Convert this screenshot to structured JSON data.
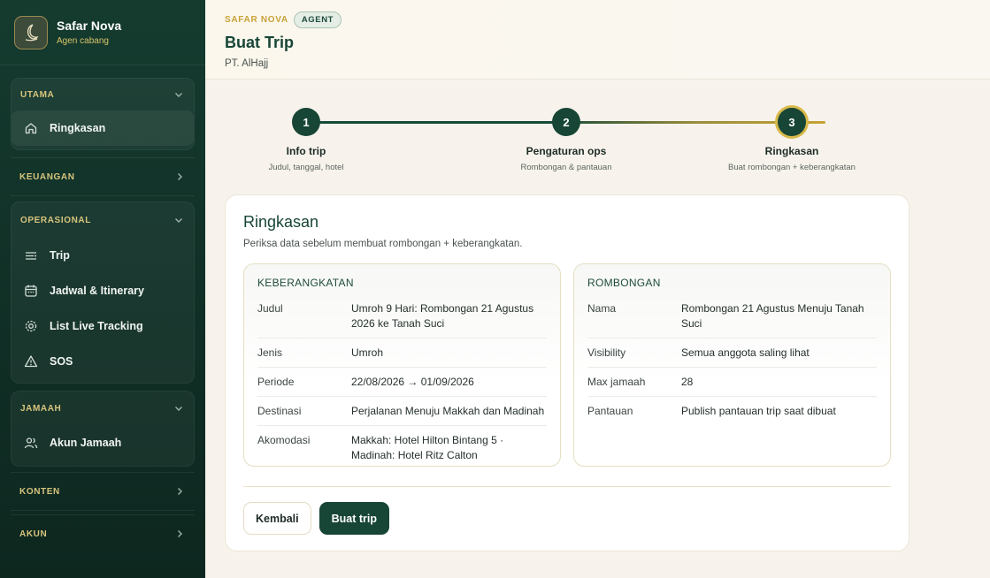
{
  "brand": {
    "name": "Safar Nova",
    "subtitle": "Agen cabang"
  },
  "sidebar": {
    "groups": [
      {
        "label": "UTAMA",
        "expanded": true,
        "items": [
          {
            "label": "Ringkasan",
            "icon": "home-icon"
          }
        ]
      },
      {
        "label": "KEUANGAN",
        "expanded": false,
        "items": []
      },
      {
        "label": "OPERASIONAL",
        "expanded": true,
        "items": [
          {
            "label": "Trip",
            "icon": "list-icon"
          },
          {
            "label": "Jadwal & Itinerary",
            "icon": "calendar-icon"
          },
          {
            "label": "List Live Tracking",
            "icon": "gear-icon"
          },
          {
            "label": "SOS",
            "icon": "warning-icon"
          }
        ]
      },
      {
        "label": "JAMAAH",
        "expanded": true,
        "items": [
          {
            "label": "Akun Jamaah",
            "icon": "users-icon"
          }
        ]
      },
      {
        "label": "KONTEN",
        "expanded": false,
        "items": []
      },
      {
        "label": "AKUN",
        "expanded": false,
        "items": []
      }
    ]
  },
  "header": {
    "kicker": "SAFAR NOVA",
    "badge": "AGENT",
    "title": "Buat Trip",
    "org": "PT. AlHajj"
  },
  "stepper": {
    "current_step": 3,
    "steps": [
      {
        "number": "1",
        "title": "Info trip",
        "subtitle": "Judul, tanggal, hotel"
      },
      {
        "number": "2",
        "title": "Pengaturan ops",
        "subtitle": "Rombongan & pantauan"
      },
      {
        "number": "3",
        "title": "Ringkasan",
        "subtitle": "Buat rombongan + keberangkatan"
      }
    ]
  },
  "summary": {
    "title": "Ringkasan",
    "subtitle": "Periksa data sebelum membuat rombongan + keberangkatan.",
    "departure": {
      "heading": "KEBERANGKATAN",
      "rows": [
        {
          "label": "Judul",
          "value": "Umroh 9 Hari: Rombongan 21 Agustus 2026 ke Tanah Suci"
        },
        {
          "label": "Jenis",
          "value": "Umroh"
        },
        {
          "label": "Periode",
          "value": "22/08/2026 → 01/09/2026"
        },
        {
          "label": "Destinasi",
          "value": "Perjalanan Menuju Makkah dan Madinah"
        },
        {
          "label": "Akomodasi",
          "value": "Makkah: Hotel Hilton Bintang 5 · Madinah: Hotel Ritz Calton"
        }
      ]
    },
    "group": {
      "heading": "ROMBONGAN",
      "rows": [
        {
          "label": "Nama",
          "value": "Rombongan 21 Agustus Menuju Tanah Suci"
        },
        {
          "label": "Visibility",
          "value": "Semua anggota saling lihat"
        },
        {
          "label": "Max jamaah",
          "value": "28"
        },
        {
          "label": "Pantauan",
          "value": "Publish pantauan trip saat dibuat"
        }
      ]
    }
  },
  "actions": {
    "back_label": "Kembali",
    "create_label": "Buat trip"
  }
}
